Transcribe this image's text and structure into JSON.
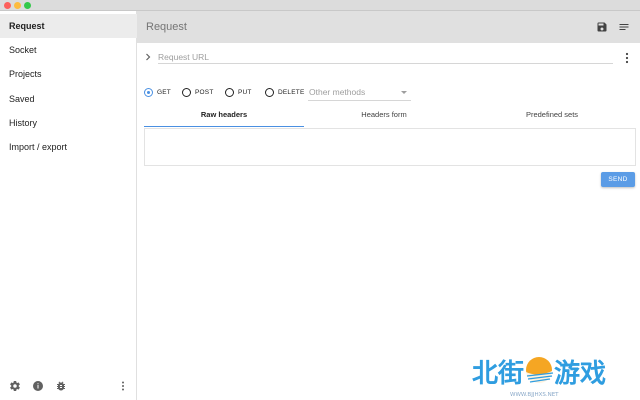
{
  "window": {
    "title_bar_colors": {
      "close": "#fc605c",
      "minimize": "#fdbc40",
      "maximize": "#34c84a"
    }
  },
  "sidebar": {
    "items": [
      {
        "label": "Request",
        "active": true
      },
      {
        "label": "Socket",
        "active": false
      },
      {
        "label": "Projects",
        "active": false
      },
      {
        "label": "Saved",
        "active": false
      },
      {
        "label": "History",
        "active": false
      },
      {
        "label": "Import / export",
        "active": false
      }
    ],
    "footer_icons": [
      "gear-icon",
      "info-icon",
      "bug-icon",
      "more-vert-icon"
    ]
  },
  "header": {
    "title": "Request",
    "icons": [
      "save-icon",
      "notes-icon"
    ]
  },
  "request": {
    "url": {
      "value": "",
      "placeholder": "Request URL"
    },
    "methods": [
      {
        "label": "GET",
        "checked": true
      },
      {
        "label": "POST",
        "checked": false
      },
      {
        "label": "PUT",
        "checked": false
      },
      {
        "label": "DELETE",
        "checked": false
      }
    ],
    "other_methods": "Other methods",
    "tabs": [
      {
        "label": "Raw headers",
        "active": true
      },
      {
        "label": "Headers form",
        "active": false
      },
      {
        "label": "Predefined sets",
        "active": false
      }
    ],
    "headers_value": "",
    "send_label": "SEND"
  },
  "watermark": {
    "text": "北街游戏",
    "url": "WWW.BJJHXS.NET"
  },
  "colors": {
    "accent": "#4a90e2",
    "send_button": "#5b9ce6",
    "watermark": "#2f9de0",
    "watermark_sun": "#f5a623"
  }
}
